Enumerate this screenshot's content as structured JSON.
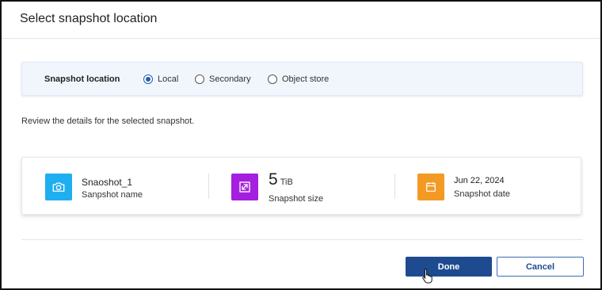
{
  "dialog": {
    "title": "Select snapshot location"
  },
  "location": {
    "label": "Snapshot location",
    "options": [
      {
        "label": "Local",
        "checked": true
      },
      {
        "label": "Secondary",
        "checked": false
      },
      {
        "label": "Object store",
        "checked": false
      }
    ]
  },
  "review_text": "Review the details for the selected snapshot.",
  "details": {
    "name": {
      "value": "Snaoshot_1",
      "caption": "Sanpshot name",
      "icon": "camera-icon",
      "color": "#1faef0"
    },
    "size": {
      "number": "5",
      "unit": "TiB",
      "caption": "Snapshot size",
      "icon": "resize-icon",
      "color": "#a41fe0"
    },
    "date": {
      "value": "Jun 22, 2024",
      "caption": "Snapshot date",
      "icon": "calendar-icon",
      "color": "#f39a25"
    }
  },
  "buttons": {
    "done": "Done",
    "cancel": "Cancel"
  },
  "colors": {
    "primary": "#1e4b8f"
  }
}
